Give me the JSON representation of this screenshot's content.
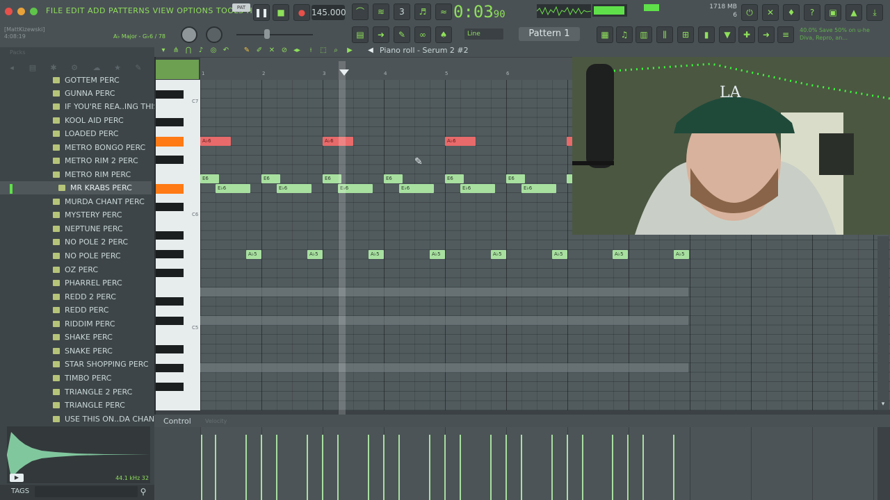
{
  "menu": {
    "items": "FILE EDIT ADD PATTERNS VIEW OPTIONS TOOLS HELP"
  },
  "transport": {
    "pat_label": "PAT",
    "tempo": "145.000",
    "time": "0:03",
    "time_frac": "90",
    "memory": "1718 MB",
    "memory_sub": "6"
  },
  "user": {
    "name": "[MattKizewski]",
    "time": "4:08:19",
    "key": "A♭ Major - G♭6 / 78"
  },
  "toolbar2": {
    "line_mode": "Line",
    "pattern": "Pattern 1",
    "hint": "40.0% Save 50% on u-he Diva, Repro, an..."
  },
  "piano_roll": {
    "title": "Piano roll - Serum 2 #2",
    "ruler": [
      "1",
      "2",
      "3",
      "4",
      "5",
      "6"
    ],
    "octaves": [
      "C7",
      "C6",
      "C5"
    ]
  },
  "browser": {
    "title": "Packs",
    "items": [
      "GOTTEM PERC",
      "GUNNA PERC",
      "IF YOU'RE REA..ING THIS PERC",
      "KOOL AID PERC",
      "LOADED PERC",
      "METRO BONGO PERC",
      "METRO RIM 2 PERC",
      "METRO RIM PERC",
      "MR KRABS PERC",
      "MURDA CHANT PERC",
      "MYSTERY PERC",
      "NEPTUNE PERC",
      "NO POLE 2 PERC",
      "NO POLE PERC",
      "OZ PERC",
      "PHARREL PERC",
      "REDD 2 PERC",
      "REDD PERC",
      "RIDDIM PERC",
      "SHAKE PERC",
      "SNAKE PERC",
      "STAR SHOPPING PERC",
      "TIMBO PERC",
      "TRIANGLE 2 PERC",
      "TRIANGLE PERC",
      "USE THIS ON..DA CHANT PERC"
    ],
    "selected_index": 8,
    "sample_rate": "44.1 kHz 32",
    "tags_label": "TAGS"
  },
  "notes": {
    "ab6": "A♭6",
    "e6": "E6",
    "eb6": "E♭6",
    "ab5": "A♭5"
  },
  "control": {
    "label": "Control",
    "sub": "Velocity"
  }
}
